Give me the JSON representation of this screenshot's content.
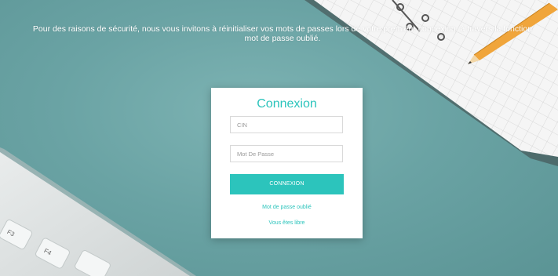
{
  "notice": {
    "text": "Pour des raisons de sécurité, nous vous invitons à réinitialiser vos mots de passes lors de votre première connexion, à travers la fonction mot de passe oublié."
  },
  "login": {
    "title": "Connexion",
    "cin_placeholder": "CIN",
    "password_placeholder": "Mot De Passe",
    "submit_label": "CONNEXION",
    "forgot_link": "Mot de passe oublié",
    "free_link": "Vous êtes libre"
  },
  "keyboard": {
    "keys": [
      "F3",
      "F4"
    ]
  },
  "colors": {
    "accent": "#2cc4bc",
    "background": "#6aa3a4"
  }
}
